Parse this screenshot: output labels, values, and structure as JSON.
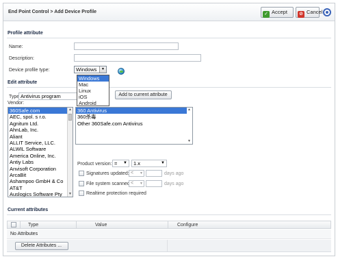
{
  "header": {
    "breadcrumb": "End Point Control > Add Device Profile",
    "accept_label": "Accept",
    "cancel_label": "Cancel"
  },
  "profile_attribute": {
    "section_title": "Profile attribute",
    "name_label": "Name:",
    "name_value": "",
    "description_label": "Description:",
    "description_value": "",
    "device_type_label": "Device profile type:",
    "device_type_value": "Windows",
    "device_type_options": [
      "Windows",
      "Mac",
      "Linux",
      "iOS",
      "Android"
    ]
  },
  "edit_attribute": {
    "section_title": "Edit attribute",
    "type_label": "Type:",
    "type_value": "Antivirus program",
    "add_button": "Add to current attribute",
    "vendor_label": "Vendor:",
    "vendors": [
      "360Safe.com",
      "AEC, spol. s r.o.",
      "Agnitum Ltd.",
      "AhnLab, Inc.",
      "Aliant",
      "ALLIT Service, LLC.",
      "ALWIL Software",
      "America Online, Inc.",
      "Antiy Labs",
      "Anvisoft Corporation",
      "ArcaBit",
      "Ashampoo GmbH & Co",
      "AT&T",
      "Auslogics Software Pty"
    ],
    "products": [
      "360 Antivirus",
      "360杀毒",
      "Other 360Safe.com Antivirus"
    ],
    "product_version_label": "Product version:",
    "product_version_op": "=",
    "product_version_value": "1.x",
    "signatures_label": "Signatures updated:",
    "signatures_op": "<",
    "file_scan_label": "File system scanned:",
    "file_scan_op": "<",
    "days_ago": "days ago",
    "realtime_label": "Realtime protection required"
  },
  "current_attributes": {
    "section_title": "Current attributes",
    "columns": [
      "Type",
      "Value",
      "Configure"
    ],
    "empty_text": "No Attributes",
    "delete_button": "Delete Attributes ..."
  },
  "colors": {
    "accent_blue": "#3a78d6",
    "accept_green": "#3f9a2e",
    "cancel_red": "#d0352b"
  }
}
